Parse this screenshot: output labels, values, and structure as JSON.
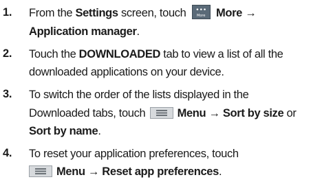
{
  "steps": [
    {
      "number": "1.",
      "lines": [
        {
          "a": "From the ",
          "b": "Settings",
          "c": " screen, touch",
          "d": "More →"
        },
        {
          "b": "Application manager",
          "c": "."
        }
      ]
    },
    {
      "number": "2.",
      "lines": [
        {
          "a": "Touch the ",
          "b": "DOWNLOADED",
          "c": " tab to view a list of all the"
        },
        {
          "a": "downloaded applications on your device."
        }
      ]
    },
    {
      "number": "3.",
      "lines": [
        {
          "a": "To switch the order of the lists displayed in the"
        },
        {
          "a": "Downloaded tabs, touch",
          "b": "Menu → Sort by size",
          "c": " or"
        },
        {
          "b": "Sort by name",
          "c": "."
        }
      ]
    },
    {
      "number": "4.",
      "lines": [
        {
          "a": "To reset your application preferences, touch"
        },
        {
          "b": "Menu → Reset app preferences",
          "c": "."
        }
      ]
    }
  ],
  "icons": {
    "more_dots": "•••",
    "more_caption": "More",
    "menu_icon": "menu-icon",
    "more_icon": "more-icon",
    "more_icon_color": "#5a6a78",
    "menu_icon_color": "#9aa0a6"
  }
}
